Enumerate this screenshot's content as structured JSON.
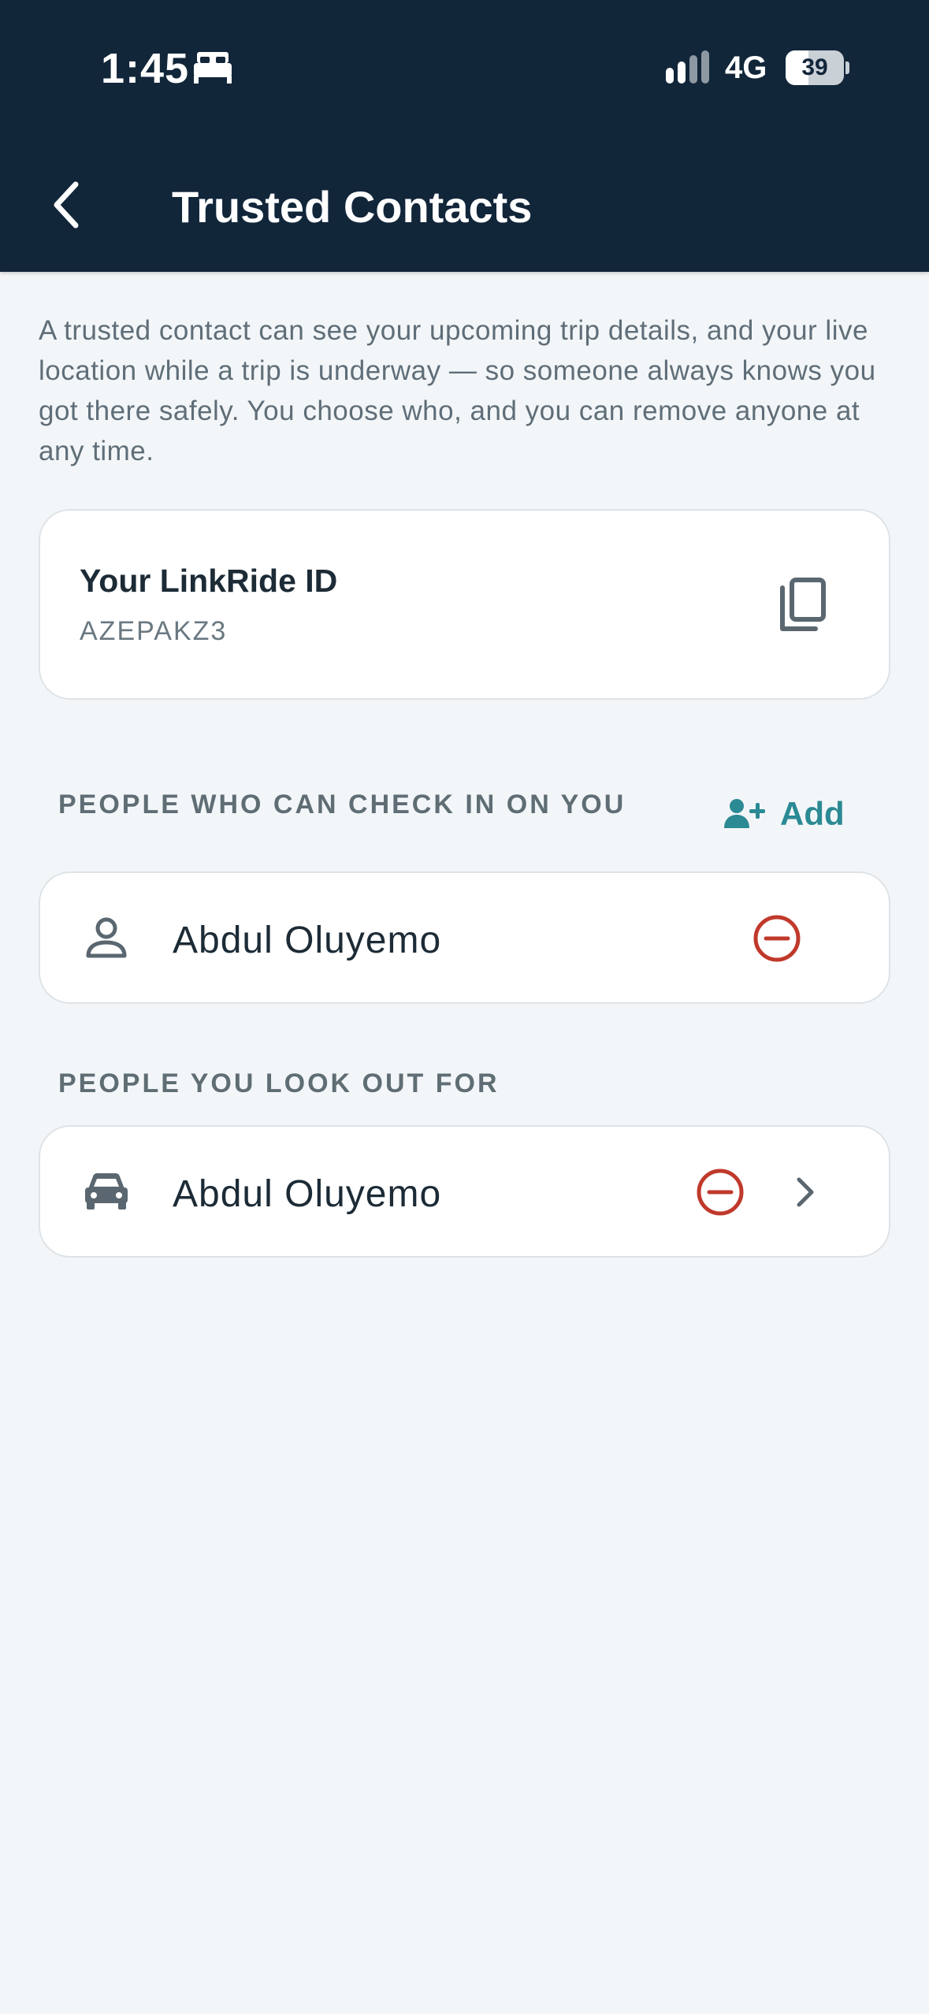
{
  "status_bar": {
    "time": "1:45",
    "network": "4G",
    "battery_percent": "39",
    "battery_level": 0.39,
    "icons": [
      "bed-icon",
      "signal-icon"
    ]
  },
  "header": {
    "title": "Trusted Contacts",
    "background_color": "#12263a",
    "back_icon": "chevron-left-icon"
  },
  "intro_text": "A trusted contact can see your upcoming trip details, and your live location while a trip is underway — so someone always knows you got there safely. You choose who, and you can remove anyone at any time.",
  "linkride_id_card": {
    "title": "Your LinkRide ID",
    "value": "AZEPAKZ3",
    "copy_icon": "copy-icon"
  },
  "check_in_section": {
    "label": "PEOPLE WHO CAN CHECK IN ON YOU",
    "add_label": "Add",
    "add_icon": "add-person-icon",
    "accent_color": "#2b8a94",
    "contacts": [
      {
        "name": "Abdul Oluyemo",
        "icon": "person-icon",
        "remove_icon": "remove-circle-icon"
      }
    ]
  },
  "look_out_section": {
    "label": "PEOPLE YOU LOOK OUT FOR",
    "contacts": [
      {
        "name": "Abdul Oluyemo",
        "icon": "car-icon",
        "remove_icon": "remove-circle-icon",
        "chevron_icon": "chevron-right-icon"
      }
    ]
  },
  "colors": {
    "remove": "#c0392b",
    "page_background": "#f3f6f8"
  }
}
